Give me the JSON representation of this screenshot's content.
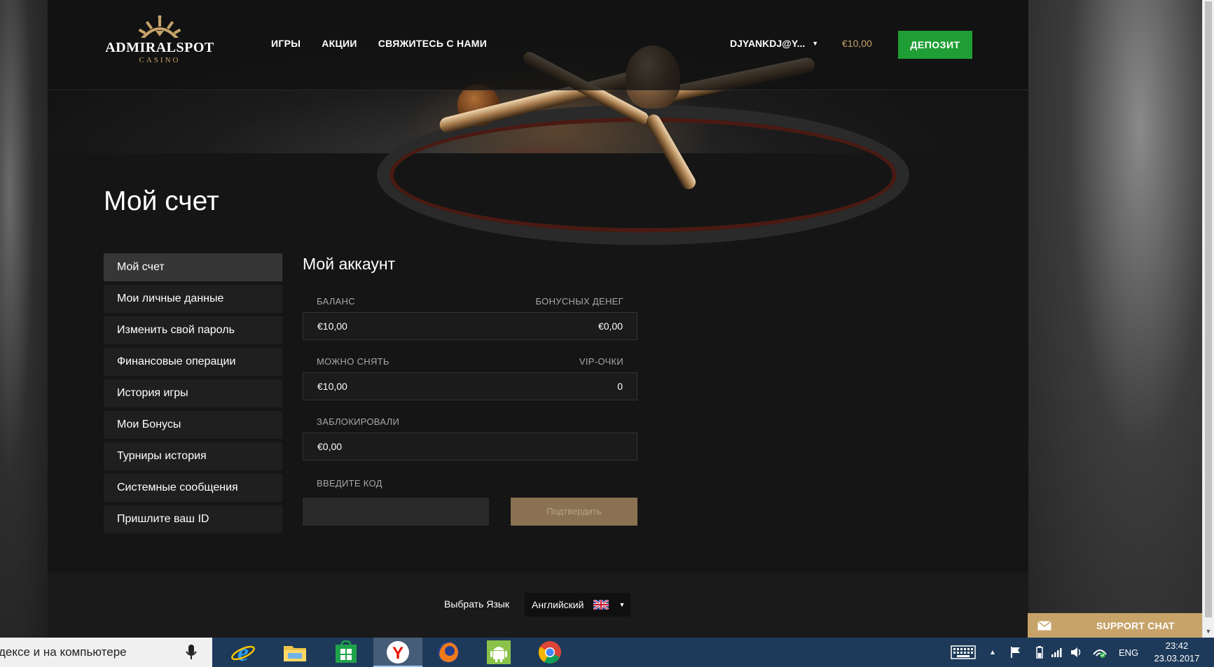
{
  "header": {
    "logo_brand": "ADMIRALSPOT",
    "logo_sub": "CASINO",
    "nav": [
      "ИГРЫ",
      "АКЦИИ",
      "СВЯЖИТЕСЬ С НАМИ"
    ],
    "user": "DJYANKDJ@Y...",
    "balance": "€10,00",
    "deposit_label": "ДЕПОЗИТ"
  },
  "page_title": "Мой счет",
  "menu": [
    "Мой счет",
    "Мои личные данные",
    "Изменить свой пароль",
    "Финансовые операции",
    "История игры",
    "Мои Бонусы",
    "Турниры история",
    "Системные сообщения",
    "Пришлите ваш ID"
  ],
  "account": {
    "title": "Мой аккаунт",
    "balance_label": "БАЛАНС",
    "balance_value": "€10,00",
    "bonus_label": "БОНУСНЫХ ДЕНЕГ",
    "bonus_value": "€0,00",
    "withdrawable_label": "МОЖНО СНЯТЬ",
    "withdrawable_value": "€10,00",
    "vip_label": "VIP-ОЧКИ",
    "vip_value": "0",
    "blocked_label": "ЗАБЛОКИРОВАЛИ",
    "blocked_value": "€0,00",
    "code_label": "ВВЕДИТЕ КОД",
    "code_placeholder": "",
    "confirm_label": "Подтвердить"
  },
  "footer": {
    "lang_label": "Выбрать Язык",
    "lang_value": "Английский"
  },
  "support": {
    "label": "SUPPORT CHAT"
  },
  "taskbar": {
    "search_text": "дексе и на компьютере",
    "tray_lang": "ENG",
    "time": "23:42",
    "date": "23.03.2017"
  },
  "colors": {
    "accent_gold": "#c7a36a",
    "deposit_green": "#1f9e35",
    "confirm_brown": "#8a7151"
  }
}
